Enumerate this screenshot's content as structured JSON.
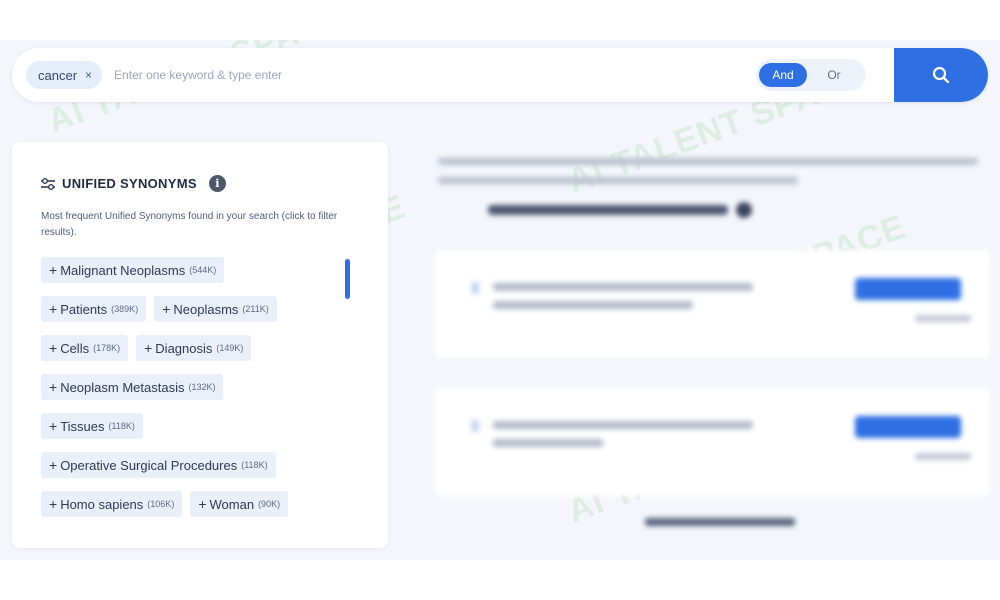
{
  "search": {
    "keyword": "cancer",
    "remove_symbol": "×",
    "placeholder": "Enter one keyword & type enter",
    "value": "",
    "operator_and": "And",
    "operator_or": "Or",
    "search_icon": "search-icon"
  },
  "watermark": "AI TALENT SPACE",
  "synonyms": {
    "title": "UNIFIED SYNONYMS",
    "info_symbol": "i",
    "description": "Most frequent Unified Synonyms found in your search (click to filter results).",
    "plus": "+",
    "rows": [
      [
        {
          "label": "Malignant Neoplasms",
          "count": "(544K)"
        }
      ],
      [
        {
          "label": "Patients",
          "count": "(389K)"
        },
        {
          "label": "Neoplasms",
          "count": "(211K)"
        }
      ],
      [
        {
          "label": "Cells",
          "count": "(178K)"
        },
        {
          "label": "Diagnosis",
          "count": "(149K)"
        }
      ],
      [
        {
          "label": "Neoplasm Metastasis",
          "count": "(132K)"
        }
      ],
      [
        {
          "label": "Tissues",
          "count": "(118K)"
        }
      ],
      [
        {
          "label": "Operative Surgical Procedures",
          "count": "(118K)"
        }
      ],
      [
        {
          "label": "Homo sapiens",
          "count": "(106K)"
        },
        {
          "label": "Woman",
          "count": "(90K)"
        }
      ]
    ]
  },
  "colors": {
    "accent": "#2e6fe3",
    "background": "#f4f6fb",
    "tag_background": "#eaf0fa"
  }
}
